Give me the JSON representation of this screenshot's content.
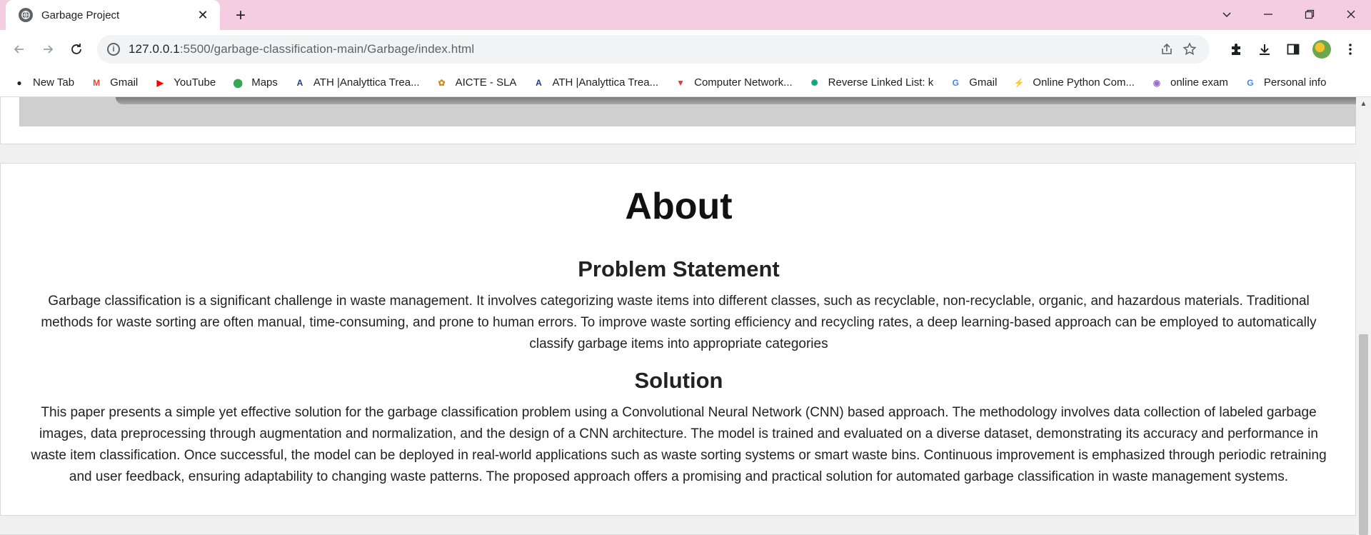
{
  "browser": {
    "tab_title": "Garbage Project",
    "tab_close": "✕",
    "new_tab": "+",
    "url_host": "127.0.0.1",
    "url_rest": ":5500/garbage-classification-main/Garbage/index.html"
  },
  "bookmarks": [
    {
      "label": "New Tab",
      "icon": "globe-icon",
      "color": "#202124",
      "glyph": "●"
    },
    {
      "label": "Gmail",
      "icon": "gmail-icon",
      "color": "#ea4335",
      "glyph": "M"
    },
    {
      "label": "YouTube",
      "icon": "youtube-icon",
      "color": "#ff0000",
      "glyph": "▶"
    },
    {
      "label": "Maps",
      "icon": "maps-icon",
      "color": "#34a853",
      "glyph": "⬤"
    },
    {
      "label": "ATH |Analyttica Trea...",
      "icon": "analyttica-icon",
      "color": "#1a3a8c",
      "glyph": "A"
    },
    {
      "label": "AICTE - SLA",
      "icon": "aicte-icon",
      "color": "#c98a1b",
      "glyph": "✿"
    },
    {
      "label": "ATH |Analyttica Trea...",
      "icon": "analyttica-icon",
      "color": "#1a3a8c",
      "glyph": "A"
    },
    {
      "label": "Computer Network...",
      "icon": "computer-network-icon",
      "color": "#e53935",
      "glyph": "▼"
    },
    {
      "label": "Reverse Linked List: k",
      "icon": "chatgpt-icon",
      "color": "#10a37f",
      "glyph": "✺"
    },
    {
      "label": "Gmail",
      "icon": "google-icon",
      "color": "#4285f4",
      "glyph": "G"
    },
    {
      "label": "Online Python Com...",
      "icon": "python-compiler-icon",
      "color": "#5b3ea6",
      "glyph": "⚡"
    },
    {
      "label": "online exam",
      "icon": "exam-icon",
      "color": "#9c6fc6",
      "glyph": "◉"
    },
    {
      "label": "Personal info",
      "icon": "google-icon",
      "color": "#4285f4",
      "glyph": "G"
    }
  ],
  "page": {
    "about_title": "About",
    "problem_heading": "Problem Statement",
    "problem_text": "Garbage classification is a significant challenge in waste management. It involves categorizing waste items into different classes, such as recyclable, non-recyclable, organic, and hazardous materials. Traditional methods for waste sorting are often manual, time-consuming, and prone to human errors. To improve waste sorting efficiency and recycling rates, a deep learning-based approach can be employed to automatically classify garbage items into appropriate categories",
    "solution_heading": "Solution",
    "solution_text": "This paper presents a simple yet effective solution for the garbage classification problem using a Convolutional Neural Network (CNN) based approach. The methodology involves data collection of labeled garbage images, data preprocessing through augmentation and normalization, and the design of a CNN architecture. The model is trained and evaluated on a diverse dataset, demonstrating its accuracy and performance in waste item classification. Once successful, the model can be deployed in real-world applications such as waste sorting systems or smart waste bins. Continuous improvement is emphasized through periodic retraining and user feedback, ensuring adaptability to changing waste patterns. The proposed approach offers a promising and practical solution for automated garbage classification in waste management systems."
  },
  "colors": {
    "titlebar": "#f4cde0",
    "toolbar": "#ffffff",
    "omnibox": "#f1f3f4"
  }
}
